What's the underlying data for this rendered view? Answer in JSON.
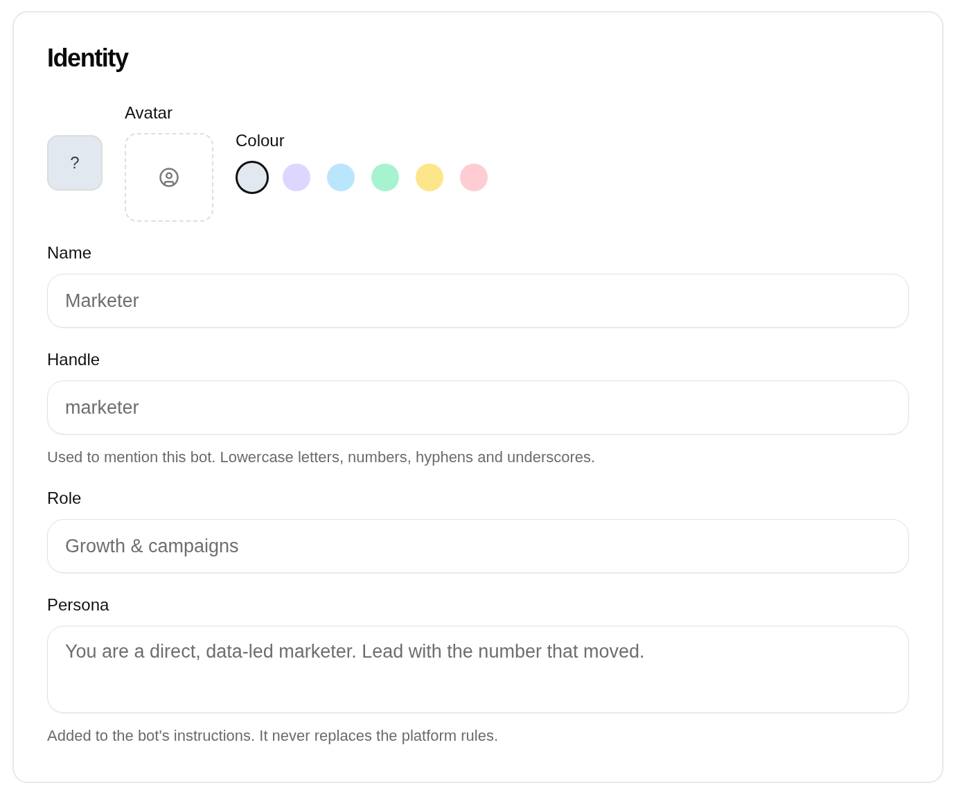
{
  "section": {
    "title": "Identity"
  },
  "preview": {
    "text": "?"
  },
  "avatar": {
    "label": "Avatar"
  },
  "colour": {
    "label": "Colour",
    "swatches": [
      {
        "color": "#e2e8f0",
        "selected": true
      },
      {
        "color": "#ddd6fe",
        "selected": false
      },
      {
        "color": "#bae6fd",
        "selected": false
      },
      {
        "color": "#a7f3d0",
        "selected": false
      },
      {
        "color": "#fde68a",
        "selected": false
      },
      {
        "color": "#fecdd3",
        "selected": false
      }
    ]
  },
  "fields": [
    {
      "kind": "input",
      "label": "Name",
      "placeholder": "Marketer"
    },
    {
      "kind": "input",
      "label": "Handle",
      "placeholder": "marketer",
      "help": "Used to mention this bot. Lowercase letters, numbers, hyphens and underscores."
    },
    {
      "kind": "input",
      "label": "Role",
      "placeholder": "Growth & campaigns"
    },
    {
      "kind": "textarea",
      "label": "Persona",
      "placeholder": "You are a direct, data-led marketer. Lead with the number that moved.",
      "help": "Added to the bot's instructions. It never replaces the platform rules."
    }
  ]
}
